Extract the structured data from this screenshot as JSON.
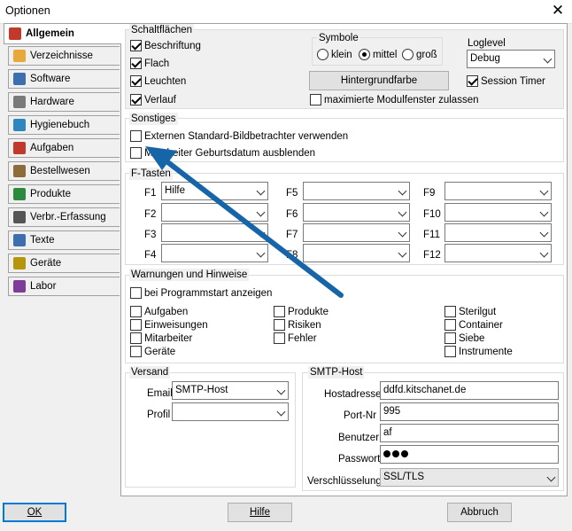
{
  "window": {
    "title": "Optionen",
    "close": "✕"
  },
  "tabs": [
    {
      "label": "Allgemein",
      "icon": "checklist-icon"
    },
    {
      "label": "Verzeichnisse",
      "icon": "folder-icon"
    },
    {
      "label": "Software",
      "icon": "software-icon"
    },
    {
      "label": "Hardware",
      "icon": "gear-icon"
    },
    {
      "label": "Hygienebuch",
      "icon": "globe-icon"
    },
    {
      "label": "Aufgaben",
      "icon": "tasks-icon"
    },
    {
      "label": "Bestellwesen",
      "icon": "order-icon"
    },
    {
      "label": "Produkte",
      "icon": "product-icon"
    },
    {
      "label": "Verbr.-Erfassung",
      "icon": "consumption-icon"
    },
    {
      "label": "Texte",
      "icon": "document-icon"
    },
    {
      "label": "Geräte",
      "icon": "devices-icon"
    },
    {
      "label": "Labor",
      "icon": "lab-icon"
    }
  ],
  "schaltflaechen": {
    "title": "Schaltflächen",
    "beschriftung": "Beschriftung",
    "flach": "Flach",
    "leuchten": "Leuchten",
    "verlauf": "Verlauf"
  },
  "symbole": {
    "title": "Symbole",
    "klein": "klein",
    "mittel": "mittel",
    "gross": "groß",
    "selected": "mittel"
  },
  "loglevel": {
    "label": "Loglevel",
    "value": "Debug"
  },
  "session_timer": "Session Timer",
  "hintergrundfarbe": "Hintergrundfarbe",
  "maximierte": "maximierte Modulfenster zulassen",
  "sonstiges": {
    "title": "Sonstiges",
    "externen": "Externen Standard-Bildbetrachter verwenden",
    "mitarbeiter": "Mitarbeiter Geburtsdatum ausblenden"
  },
  "ftasten": {
    "title": "F-Tasten",
    "keys": [
      "F1",
      "F2",
      "F3",
      "F4",
      "F5",
      "F6",
      "F7",
      "F8",
      "F9",
      "F10",
      "F11",
      "F12"
    ],
    "f1_value": "Hilfe"
  },
  "warnungen": {
    "title": "Warnungen und Hinweise",
    "startup": "bei Programmstart anzeigen",
    "col1": [
      "Aufgaben",
      "Einweisungen",
      "Mitarbeiter",
      "Geräte"
    ],
    "col2": [
      "Produkte",
      "Risiken",
      "Fehler"
    ],
    "col3": [
      "Sterilgut",
      "Container",
      "Siebe",
      "Instrumente"
    ]
  },
  "versand": {
    "title": "Versand",
    "email_label": "Email",
    "email_value": "SMTP-Host",
    "profil_label": "Profil",
    "profil_value": ""
  },
  "smtp": {
    "title": "SMTP-Host",
    "host_label": "Hostadresse",
    "host_value": "ddfd.kitschanet.de",
    "port_label": "Port-Nr",
    "port_value": "995",
    "user_label": "Benutzer",
    "user_value": "af",
    "pass_label": "Passwort",
    "enc_label": "Verschlüsselung",
    "enc_value": "SSL/TLS"
  },
  "buttons": {
    "ok": "OK",
    "hilfe": "Hilfe",
    "abbruch": "Abbruch"
  },
  "colors": {
    "accent": "#0078d7",
    "arrow": "#1565a8"
  }
}
